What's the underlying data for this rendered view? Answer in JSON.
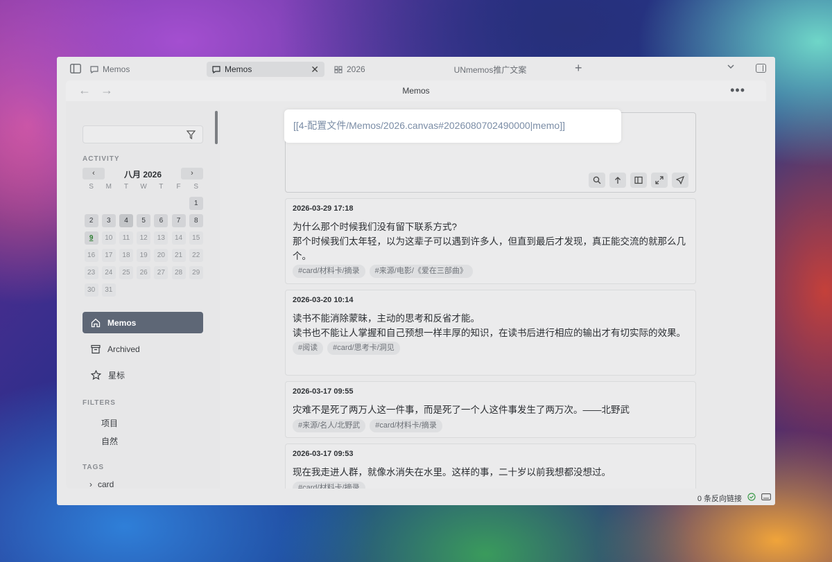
{
  "tabbar": {
    "tabs": [
      {
        "label": "Memos"
      },
      {
        "label": "Memos"
      },
      {
        "label": "2026"
      }
    ],
    "window_title": "UNmemos推广文案"
  },
  "pane": {
    "title": "Memos"
  },
  "sidebar": {
    "search": {
      "placeholder": ""
    },
    "activity_heading": "ACTIVITY",
    "calendar": {
      "month": "八月 2026",
      "prev": "‹",
      "next": "›",
      "weekdays": [
        "S",
        "M",
        "T",
        "W",
        "T",
        "F",
        "S"
      ],
      "days": [
        {
          "d": "",
          "lv": "empty"
        },
        {
          "d": "",
          "lv": "empty"
        },
        {
          "d": "",
          "lv": "empty"
        },
        {
          "d": "",
          "lv": "empty"
        },
        {
          "d": "",
          "lv": "empty"
        },
        {
          "d": "",
          "lv": "empty"
        },
        {
          "d": "1",
          "lv": "lv1"
        },
        {
          "d": "2",
          "lv": "lv1"
        },
        {
          "d": "3",
          "lv": "lv1"
        },
        {
          "d": "4",
          "lv": "lv2"
        },
        {
          "d": "5",
          "lv": "lv1"
        },
        {
          "d": "6",
          "lv": "lv1"
        },
        {
          "d": "7",
          "lv": "lv1"
        },
        {
          "d": "8",
          "lv": "lv1"
        },
        {
          "d": "9",
          "lv": "today"
        },
        {
          "d": "10",
          "lv": ""
        },
        {
          "d": "11",
          "lv": ""
        },
        {
          "d": "12",
          "lv": ""
        },
        {
          "d": "13",
          "lv": ""
        },
        {
          "d": "14",
          "lv": ""
        },
        {
          "d": "15",
          "lv": ""
        },
        {
          "d": "16",
          "lv": ""
        },
        {
          "d": "17",
          "lv": ""
        },
        {
          "d": "18",
          "lv": ""
        },
        {
          "d": "19",
          "lv": ""
        },
        {
          "d": "20",
          "lv": ""
        },
        {
          "d": "21",
          "lv": ""
        },
        {
          "d": "22",
          "lv": ""
        },
        {
          "d": "23",
          "lv": ""
        },
        {
          "d": "24",
          "lv": ""
        },
        {
          "d": "25",
          "lv": ""
        },
        {
          "d": "26",
          "lv": ""
        },
        {
          "d": "27",
          "lv": ""
        },
        {
          "d": "28",
          "lv": ""
        },
        {
          "d": "29",
          "lv": ""
        },
        {
          "d": "30",
          "lv": ""
        },
        {
          "d": "31",
          "lv": ""
        }
      ]
    },
    "nav": {
      "memos": "Memos",
      "archived": "Archived",
      "starred": "星标"
    },
    "filters_heading": "FILTERS",
    "filters": [
      "项目",
      "自然"
    ],
    "tags_heading": "TAGS",
    "tags": [
      "card"
    ]
  },
  "editor": {
    "link_text": "[[4-配置文件/Memos/2026.canvas#2026080702490000|memo]]"
  },
  "memos": [
    {
      "time": "2026-03-29 17:18",
      "lines": [
        "为什么那个时候我们没有留下联系方式?",
        "那个时候我们太年轻，以为这辈子可以遇到许多人，但直到最后才发现，真正能交流的就那么几个。"
      ],
      "tags": [
        "#card/材料卡/摘录",
        "#来源/电影/《爱在三部曲》"
      ]
    },
    {
      "time": "2026-03-20 10:14",
      "lines": [
        "读书不能消除蒙昧，主动的思考和反省才能。",
        "读书也不能让人掌握和自己预想一样丰厚的知识，在读书后进行相应的输出才有切实际的效果。"
      ],
      "tags": [
        "#阅读",
        "#card/思考卡/洞见"
      ]
    },
    {
      "time": "2026-03-17 09:55",
      "text": "灾难不是死了两万人这一件事，而是死了一个人这件事发生了两万次。——北野武",
      "tags": [
        "#来源/名人/北野武",
        "#card/材料卡/摘录"
      ]
    },
    {
      "time": "2026-03-17 09:53",
      "text": "现在我走进人群，就像水消失在水里。这样的事，二十岁以前我想都没想过。",
      "tags": [
        "#card/材料卡/摘录"
      ]
    }
  ],
  "statusbar": {
    "backlinks": "0 条反向链接"
  }
}
